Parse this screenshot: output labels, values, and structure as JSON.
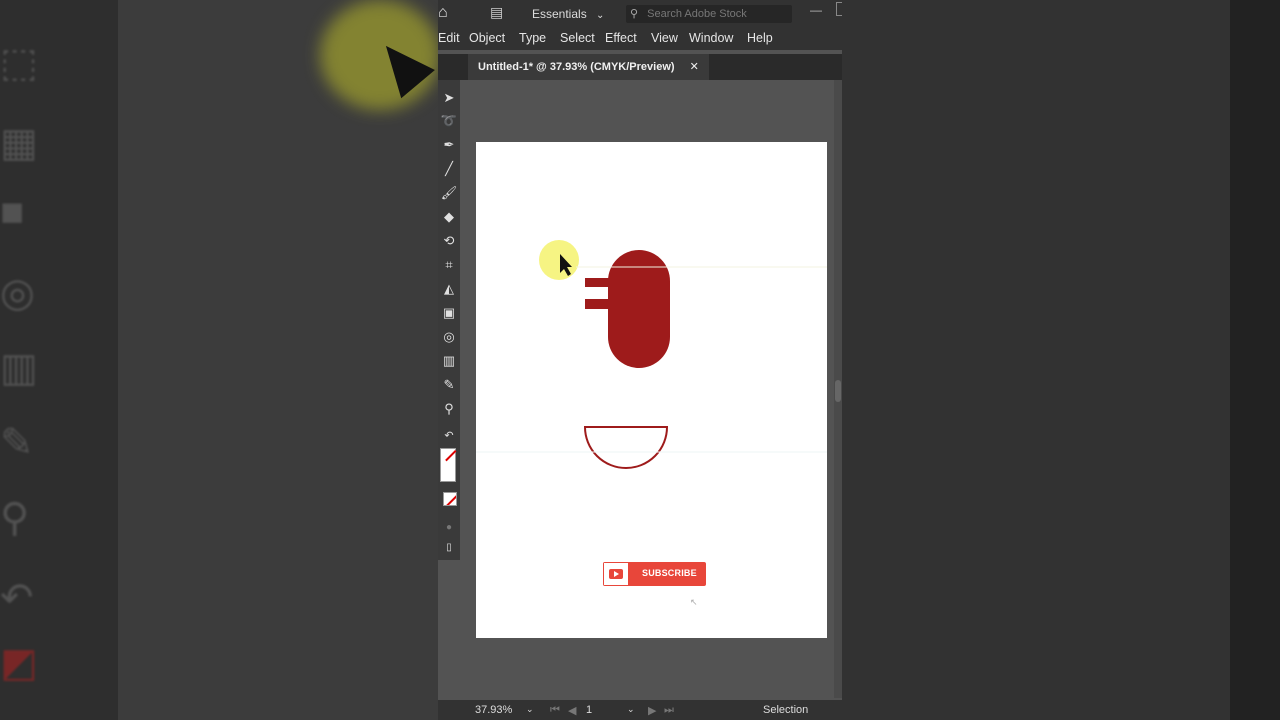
{
  "topbar": {
    "workspace": "Essentials",
    "search_placeholder": "Search Adobe Stock",
    "home_icon": "home-icon",
    "layout_icon": "workspace-layout-icon",
    "minimize_icon": "minimize-icon"
  },
  "menubar": {
    "items": [
      "Edit",
      "Object",
      "Type",
      "Select",
      "Effect",
      "View",
      "Window",
      "Help"
    ]
  },
  "document": {
    "tab_title": "Untitled-1* @ 37.93% (CMYK/Preview)",
    "close_label": "✕"
  },
  "artwork": {
    "subscribe_label": "SUBSCRIBE",
    "shape_color": "#9e1b1b",
    "subscribe_color": "#e8463a"
  },
  "status": {
    "zoom": "37.93%",
    "artboard_number": "1",
    "tool_name": "Selection"
  },
  "tools": [
    "selection-tool-icon",
    "lasso-tool-icon",
    "pen-tool-icon",
    "line-tool-icon",
    "paintbrush-tool-icon",
    "eraser-tool-icon",
    "rotate-tool-icon",
    "free-transform-tool-icon",
    "shape-builder-tool-icon",
    "gradient-tool-icon",
    "blend-tool-icon",
    "graph-tool-icon",
    "eyedropper-tool-icon",
    "zoom-tool-icon",
    "swap-colors-icon",
    "fill-stroke-icon",
    "none-color-icon"
  ]
}
